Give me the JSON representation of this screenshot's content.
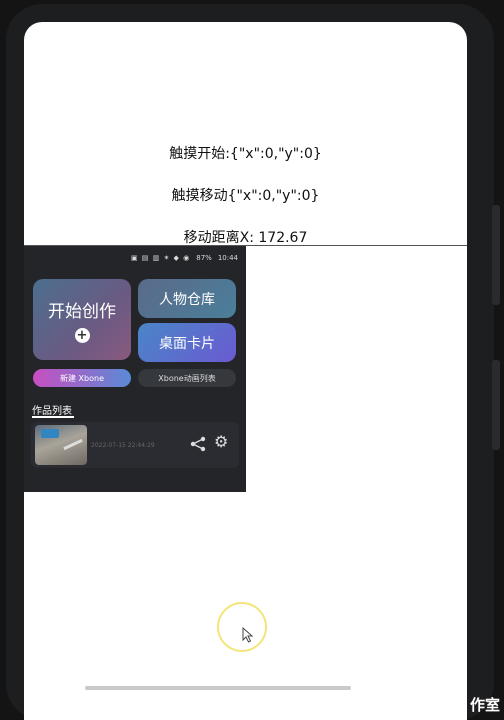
{
  "touch_info": {
    "start": "触摸开始:{\"x\":0,\"y\":0}",
    "move": "触摸移动{\"x\":0,\"y\":0}",
    "distance": "移动距离X: 172.67"
  },
  "card": {
    "statusbar": {
      "icons": "▣ ▤ ▥ ✶ ◆ ◉",
      "battery": "87%",
      "time": "10:44"
    },
    "tiles": {
      "start_create": "开始创作",
      "plus": "+",
      "character_library": "人物仓库",
      "desktop_card": "桌面卡片"
    },
    "pills": {
      "new_xbone": "新建 Xbone",
      "xbone_animation_list": "Xbone动画列表"
    },
    "works": {
      "title": "作品列表",
      "items": [
        {
          "date": "2022-07-15 22:44:29"
        }
      ]
    }
  },
  "watermark": "作室",
  "colors": {
    "card_background": "#232529",
    "new_pill_start": "#c84fc0",
    "new_pill_end": "#5a8ad6",
    "desk_tile_start": "#4a86c8",
    "desk_tile_end": "#6a5ad0",
    "touch_ring": "#f3e57a"
  },
  "icons": [
    "share-icon",
    "gear-icon",
    "plus-icon",
    "cursor-icon"
  ]
}
